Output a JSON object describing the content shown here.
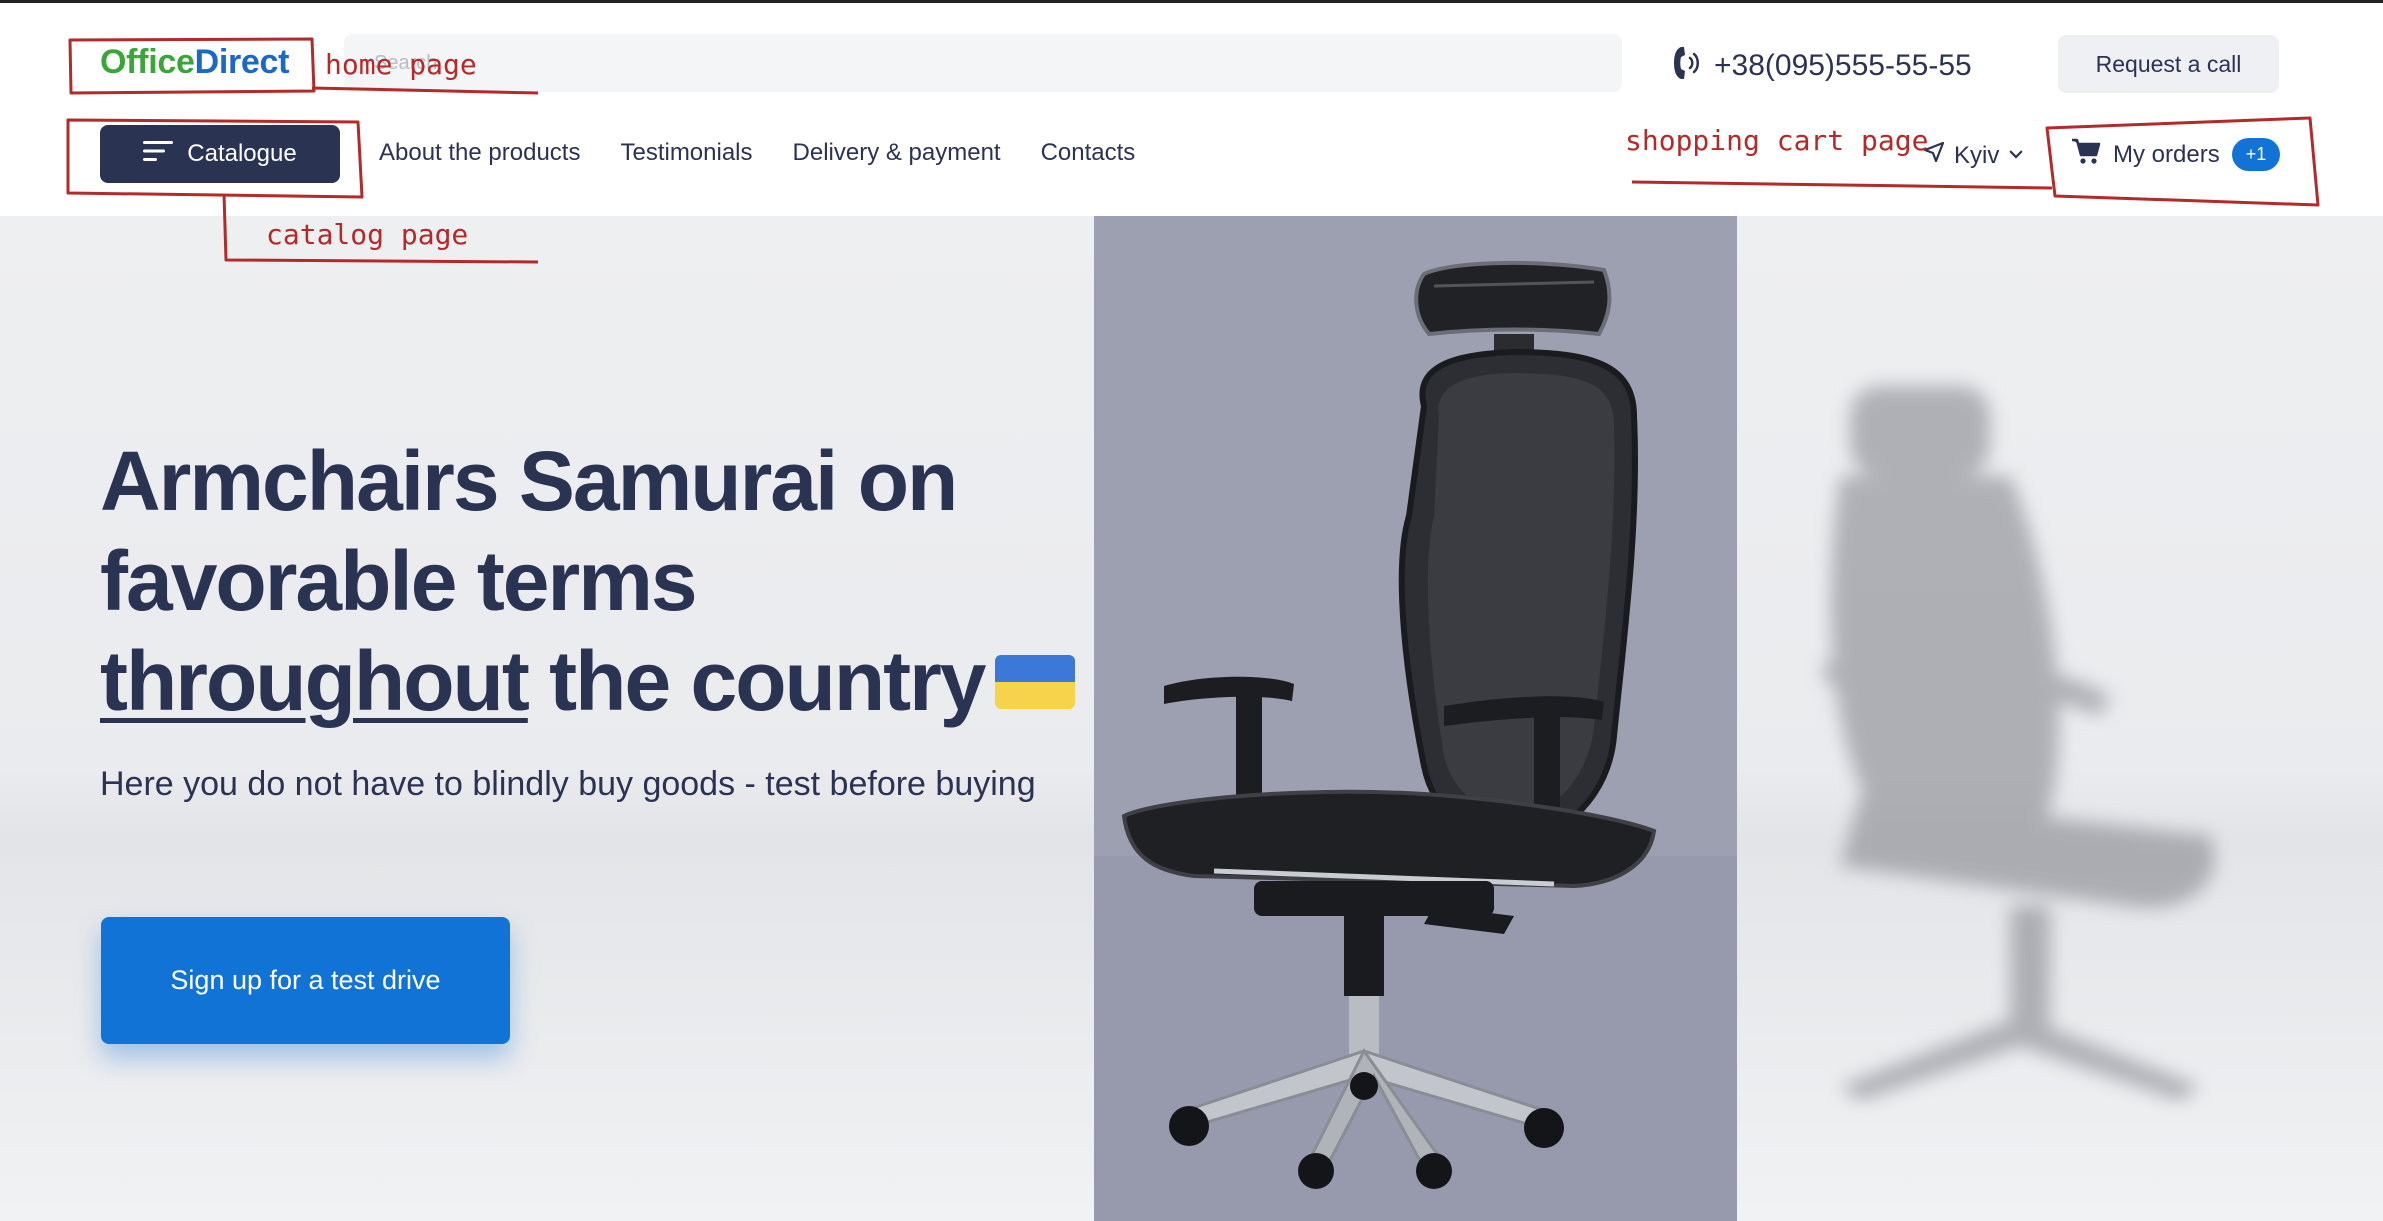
{
  "header": {
    "logo": {
      "part1": "Office",
      "part2": "Direct"
    },
    "search": {
      "placeholder": "Search"
    },
    "phone": "+38(095)555-55-55",
    "request_call_label": "Request a call",
    "catalogue_label": "Catalogue",
    "nav": [
      "About the products",
      "Testimonials",
      "Delivery & payment",
      "Contacts"
    ],
    "city": "Kyiv",
    "orders_label": "My orders",
    "orders_badge": "+1"
  },
  "hero": {
    "title_line1": "Armchairs Samurai on",
    "title_line2": "favorable terms",
    "title_underlined": "throughout",
    "title_rest": "the country",
    "subtitle": "Here you do not have to blindly buy goods - test before buying",
    "cta_label": "Sign up for a test drive"
  },
  "annotations": {
    "home": "home page",
    "catalog": "catalog page",
    "cart": "shopping cart page"
  },
  "colors": {
    "brand_green": "#3aa63a",
    "brand_blue": "#1b69c7",
    "dark_navy": "#2b3352",
    "cta_blue": "#1273d6",
    "annotation_red": "#b22a2a"
  },
  "icons": [
    "phone-icon",
    "menu-icon",
    "location-arrow-icon",
    "chevron-down-icon",
    "cart-icon"
  ]
}
